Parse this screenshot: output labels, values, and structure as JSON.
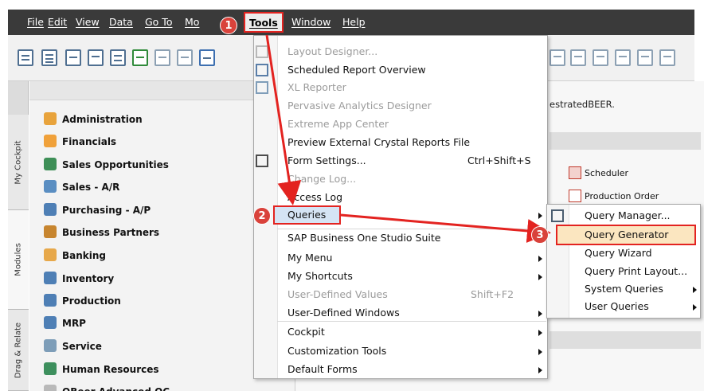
{
  "menubar": {
    "items": [
      {
        "label": "File"
      },
      {
        "label": "Edit"
      },
      {
        "label": "View"
      },
      {
        "label": "Data"
      },
      {
        "label": "Go To"
      },
      {
        "label": "Mo"
      },
      {
        "label": "Tools"
      },
      {
        "label": "Window"
      },
      {
        "label": "Help"
      }
    ]
  },
  "left_tabs": [
    {
      "label": "My Cockpit"
    },
    {
      "label": "Modules"
    },
    {
      "label": "Drag & Relate"
    }
  ],
  "nav": {
    "items": [
      {
        "label": "Administration",
        "icon": "administration-icon",
        "color": "#e8a33c"
      },
      {
        "label": "Financials",
        "icon": "financials-icon",
        "color": "#f0a13a"
      },
      {
        "label": "Sales Opportunities",
        "icon": "sales-opportunities-icon",
        "color": "#3e8f57"
      },
      {
        "label": "Sales - A/R",
        "icon": "sales-ar-icon",
        "color": "#5a8ec2"
      },
      {
        "label": "Purchasing - A/P",
        "icon": "purchasing-icon",
        "color": "#4e7fb5"
      },
      {
        "label": "Business Partners",
        "icon": "business-partners-icon",
        "color": "#c7852f"
      },
      {
        "label": "Banking",
        "icon": "banking-icon",
        "color": "#e7a84a"
      },
      {
        "label": "Inventory",
        "icon": "inventory-icon",
        "color": "#4e7fb5"
      },
      {
        "label": "Production",
        "icon": "production-icon",
        "color": "#4e7fb5"
      },
      {
        "label": "MRP",
        "icon": "mrp-icon",
        "color": "#4e7fb5"
      },
      {
        "label": "Service",
        "icon": "service-icon",
        "color": "#7d9db8"
      },
      {
        "label": "Human Resources",
        "icon": "human-resources-icon",
        "color": "#3d8f5d"
      },
      {
        "label": "OBeer Advanced QC",
        "icon": "qc-icon",
        "color": "#b9b9b9"
      }
    ]
  },
  "right_pane": {
    "notice": "estratedBEER.",
    "items": [
      {
        "label": "Scheduler"
      },
      {
        "label": "Production Order"
      }
    ]
  },
  "tools_menu": {
    "items": [
      {
        "label": "Layout Designer...",
        "disabled": true
      },
      {
        "label": "Scheduled Report Overview",
        "disabled": false
      },
      {
        "label": "XL Reporter",
        "disabled": true
      },
      {
        "label": "Pervasive Analytics Designer",
        "disabled": true
      },
      {
        "label": "Extreme App Center",
        "disabled": true
      },
      {
        "label": "Preview External Crystal Reports File",
        "disabled": false
      },
      {
        "label": "Form Settings...",
        "disabled": false,
        "shortcut": "Ctrl+Shift+S"
      },
      {
        "label": "Change Log...",
        "disabled": true
      },
      {
        "label": "Access Log",
        "disabled": false
      },
      {
        "label": "Queries",
        "disabled": false,
        "submenu": true
      },
      {
        "label": "SAP Business One Studio Suite",
        "disabled": false
      },
      {
        "label": "My Menu",
        "disabled": false,
        "submenu": true
      },
      {
        "label": "My Shortcuts",
        "disabled": false,
        "submenu": true
      },
      {
        "label": "User-Defined Values",
        "disabled": true,
        "shortcut": "Shift+F2"
      },
      {
        "label": "User-Defined Windows",
        "disabled": false,
        "submenu": true
      },
      {
        "label": "Cockpit",
        "disabled": false,
        "submenu": true
      },
      {
        "label": "Customization Tools",
        "disabled": false,
        "submenu": true
      },
      {
        "label": "Default Forms",
        "disabled": false,
        "submenu": true
      }
    ]
  },
  "queries_submenu": {
    "items": [
      {
        "label": "Query Manager..."
      },
      {
        "label": "Query Generator"
      },
      {
        "label": "Query Wizard"
      },
      {
        "label": "Query Print Layout..."
      },
      {
        "label": "System Queries",
        "submenu": true
      },
      {
        "label": "User Queries",
        "submenu": true
      }
    ]
  },
  "annotations": {
    "steps": [
      "1",
      "2",
      "3"
    ],
    "color": "#e32320"
  }
}
